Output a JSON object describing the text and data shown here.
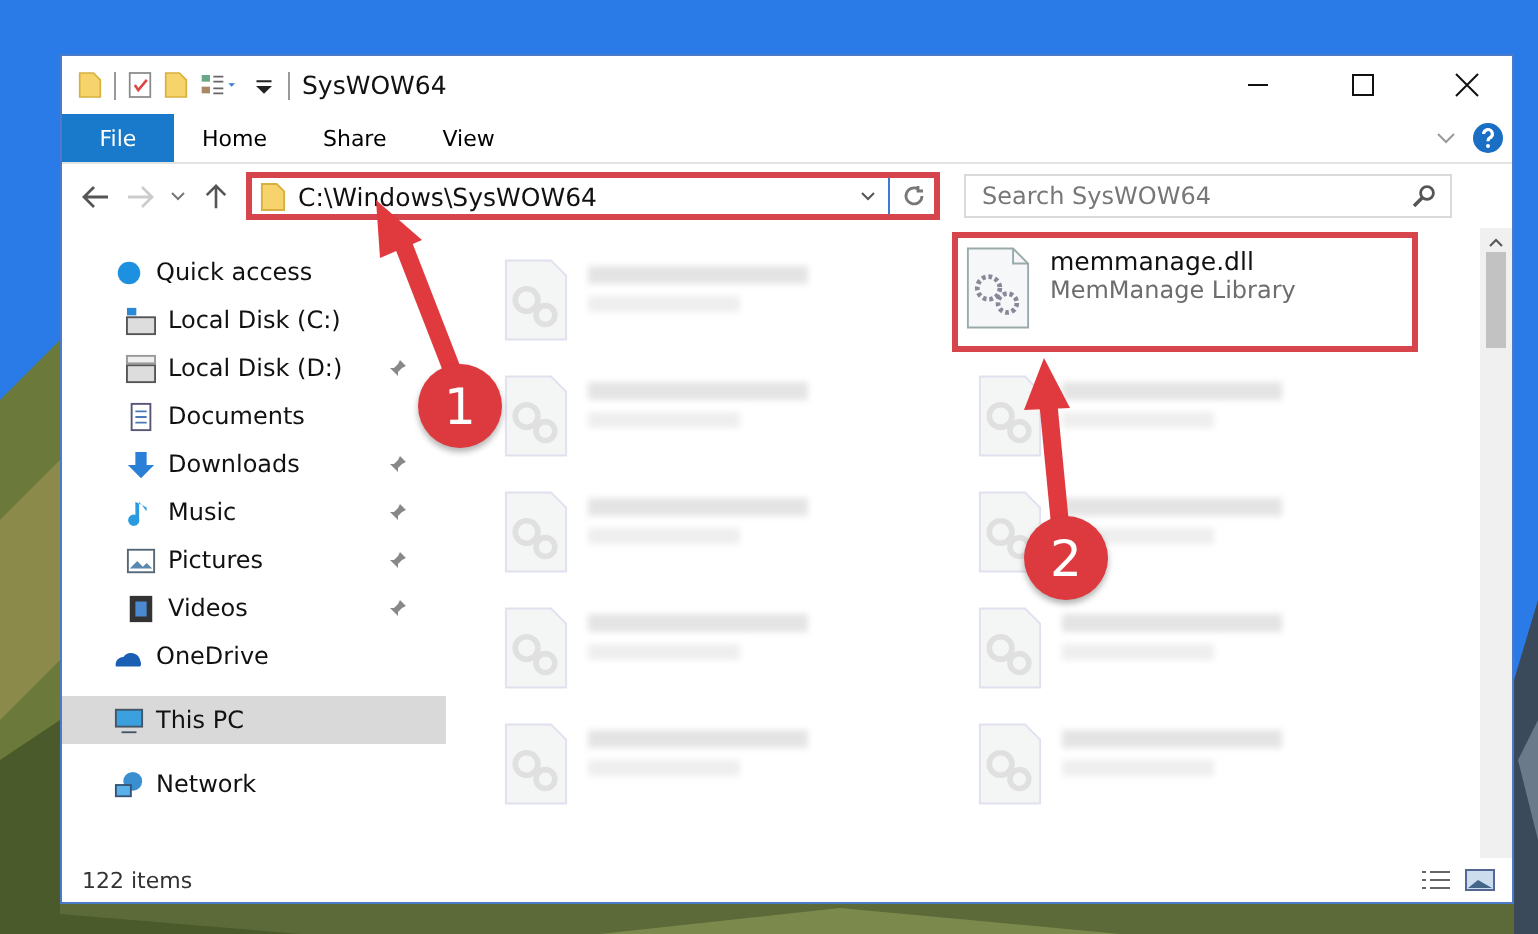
{
  "window": {
    "title": "SysWOW64"
  },
  "ribbon": {
    "file": "File",
    "tabs": [
      "Home",
      "Share",
      "View"
    ]
  },
  "address": {
    "path": "C:\\Windows\\SysWOW64",
    "highlighted": true
  },
  "search": {
    "placeholder": "Search SysWOW64"
  },
  "sidebar": {
    "items": [
      {
        "label": "Quick access",
        "kind": "star",
        "selected": false,
        "children": [
          {
            "label": "Local Disk (C:)",
            "kind": "drive-c",
            "pinned": false,
            "selected": false
          },
          {
            "label": "Local Disk (D:)",
            "kind": "drive",
            "pinned": true,
            "selected": false
          },
          {
            "label": "Documents",
            "kind": "documents",
            "pinned": false,
            "selected": false
          },
          {
            "label": "Downloads",
            "kind": "downloads",
            "pinned": true,
            "selected": false
          },
          {
            "label": "Music",
            "kind": "music",
            "pinned": true,
            "selected": false
          },
          {
            "label": "Pictures",
            "kind": "pictures",
            "pinned": true,
            "selected": false
          },
          {
            "label": "Videos",
            "kind": "videos",
            "pinned": true,
            "selected": false
          }
        ]
      },
      {
        "label": "OneDrive",
        "kind": "cloud",
        "selected": false
      },
      {
        "label": "This PC",
        "kind": "pc",
        "selected": true
      },
      {
        "label": "Network",
        "kind": "network",
        "selected": false
      }
    ]
  },
  "files": [
    {
      "kind": "blurred",
      "highlighted": false
    },
    {
      "kind": "file",
      "name": "memmanage.dll",
      "type": "MemManage Library",
      "highlighted": true
    },
    {
      "kind": "blurred",
      "highlighted": false
    },
    {
      "kind": "blurred",
      "highlighted": false
    },
    {
      "kind": "blurred",
      "highlighted": false
    },
    {
      "kind": "blurred",
      "highlighted": false
    },
    {
      "kind": "blurred",
      "highlighted": false
    },
    {
      "kind": "blurred",
      "highlighted": false
    },
    {
      "kind": "blurred",
      "highlighted": false
    },
    {
      "kind": "blurred",
      "highlighted": false
    }
  ],
  "status_bar": "122 items",
  "annotations": [
    {
      "label": "1"
    },
    {
      "label": "2"
    }
  ]
}
